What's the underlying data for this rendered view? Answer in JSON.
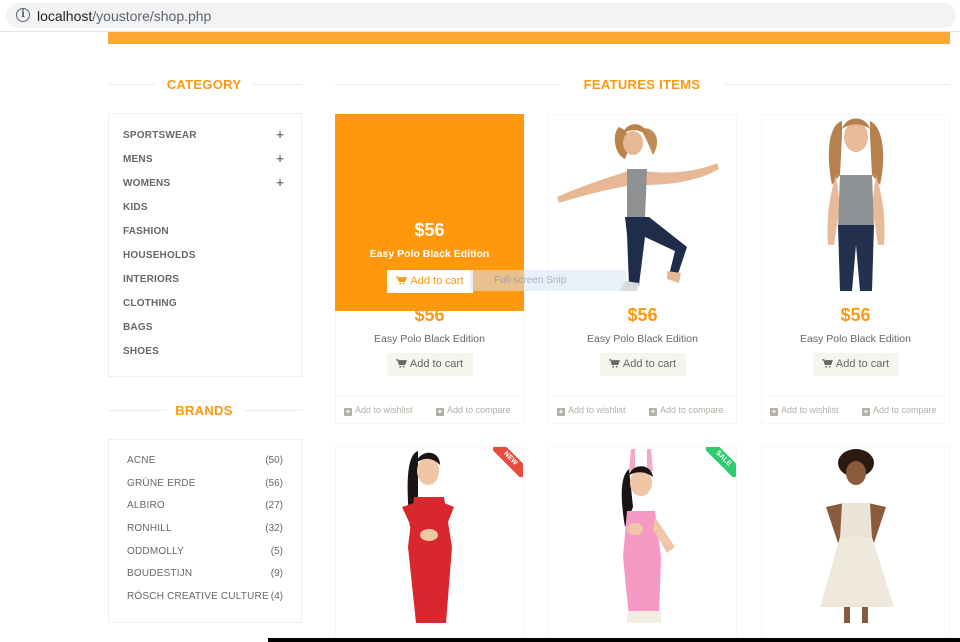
{
  "browser": {
    "url_host": "localhost",
    "url_path": "/youstore/shop.php"
  },
  "sidebar": {
    "category_title": "CATEGORY",
    "categories": [
      {
        "label": "SPORTSWEAR",
        "expandable": true
      },
      {
        "label": "MENS",
        "expandable": true
      },
      {
        "label": "WOMENS",
        "expandable": true
      },
      {
        "label": "KIDS",
        "expandable": false
      },
      {
        "label": "FASHION",
        "expandable": false
      },
      {
        "label": "HOUSEHOLDS",
        "expandable": false
      },
      {
        "label": "INTERIORS",
        "expandable": false
      },
      {
        "label": "CLOTHING",
        "expandable": false
      },
      {
        "label": "BAGS",
        "expandable": false
      },
      {
        "label": "SHOES",
        "expandable": false
      }
    ],
    "expand_symbol": "+",
    "brands_title": "BRANDS",
    "brands": [
      {
        "name": "ACNE",
        "count": "(50)"
      },
      {
        "name": "GRÜNE ERDE",
        "count": "(56)"
      },
      {
        "name": "ALBIRO",
        "count": "(27)"
      },
      {
        "name": "RONHILL",
        "count": "(32)"
      },
      {
        "name": "ODDMOLLY",
        "count": "(5)"
      },
      {
        "name": "BOUDESTIJN",
        "count": "(9)"
      },
      {
        "name": "RÖSCH CREATIVE CULTURE",
        "count": "(4)"
      }
    ]
  },
  "features": {
    "title": "FEATURES ITEMS",
    "products": [
      {
        "price": "$56",
        "name": "Easy Polo Black Edition",
        "cart": "Add to cart",
        "wishlist": "Add to wishlist",
        "compare": "Add to compare"
      },
      {
        "price": "$56",
        "name": "Easy Polo Black Edition",
        "cart": "Add to cart",
        "wishlist": "Add to wishlist",
        "compare": "Add to compare"
      },
      {
        "price": "$56",
        "name": "Easy Polo Black Edition",
        "cart": "Add to cart",
        "wishlist": "Add to wishlist",
        "compare": "Add to compare"
      }
    ],
    "overlay": {
      "price": "$56",
      "name": "Easy Polo Black Edition",
      "cart": "Add to cart"
    },
    "ribbons": {
      "new": "NEW",
      "sale": "SALE"
    }
  },
  "snip_tooltip": "Full-screen Snip",
  "colors": {
    "accent": "#fe980f",
    "new_ribbon": "#e74c3c",
    "sale_ribbon": "#2ecc71"
  }
}
